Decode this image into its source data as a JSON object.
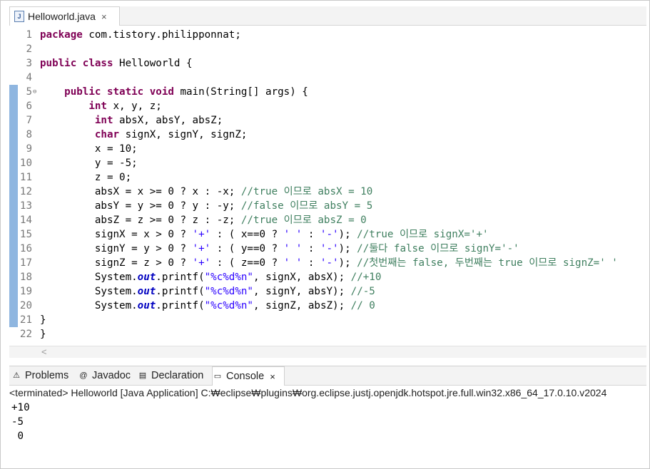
{
  "editor": {
    "tab": {
      "title": "Helloworld.java",
      "close": "×",
      "icon": "J"
    },
    "lines": [
      {
        "n": "1",
        "mark": false,
        "fold": "",
        "html": "<span class=\"kw\">package</span> com.tistory.philipponnat;"
      },
      {
        "n": "2",
        "mark": false,
        "fold": "",
        "html": ""
      },
      {
        "n": "3",
        "mark": false,
        "fold": "",
        "html": "<span class=\"kw\">public</span> <span class=\"kw\">class</span> Helloworld {"
      },
      {
        "n": "4",
        "mark": false,
        "fold": "",
        "html": ""
      },
      {
        "n": "5",
        "mark": true,
        "fold": "⊖",
        "html": "    <span class=\"kw\">public</span> <span class=\"kw\">static</span> <span class=\"kw\">void</span> main(String[] args) {"
      },
      {
        "n": "6",
        "mark": true,
        "fold": "",
        "html": "        <span class=\"kw\">int</span> x, y, z;"
      },
      {
        "n": "7",
        "mark": true,
        "fold": "",
        "html": "         <span class=\"kw\">int</span> absX, absY, absZ;"
      },
      {
        "n": "8",
        "mark": true,
        "fold": "",
        "html": "         <span class=\"kw\">char</span> signX, signY, signZ;"
      },
      {
        "n": "9",
        "mark": true,
        "fold": "",
        "html": "         x = 10;"
      },
      {
        "n": "10",
        "mark": true,
        "fold": "",
        "html": "         y = -5;"
      },
      {
        "n": "11",
        "mark": true,
        "fold": "",
        "html": "         z = 0;"
      },
      {
        "n": "12",
        "mark": true,
        "fold": "",
        "html": "         absX = x >= 0 ? x : -x; <span class=\"cm\">//true 이므로 absX = 10</span>"
      },
      {
        "n": "13",
        "mark": true,
        "fold": "",
        "html": "         absY = y >= 0 ? y : -y; <span class=\"cm\">//false 이므로 absY = 5</span>"
      },
      {
        "n": "14",
        "mark": true,
        "fold": "",
        "html": "         absZ = z >= 0 ? z : -z; <span class=\"cm\">//true 이므로 absZ = 0</span>"
      },
      {
        "n": "15",
        "mark": true,
        "fold": "",
        "html": "         signX = x > 0 ? <span class=\"str\">'+'</span> : ( x==0 ? <span class=\"str\">' '</span> : <span class=\"str\">'-'</span>); <span class=\"cm\">//true 이므로 signX='+'</span>"
      },
      {
        "n": "16",
        "mark": true,
        "fold": "",
        "html": "         signY = y > 0 ? <span class=\"str\">'+'</span> : ( y==0 ? <span class=\"str\">' '</span> : <span class=\"str\">'-'</span>); <span class=\"cm\">//둘다 false 이므로 signY='-'</span>"
      },
      {
        "n": "17",
        "mark": true,
        "fold": "",
        "html": "         signZ = z > 0 ? <span class=\"str\">'+'</span> : ( z==0 ? <span class=\"str\">' '</span> : <span class=\"str\">'-'</span>); <span class=\"cm\">//첫번째는 false, 두번째는 true 이므로 signZ=' '</span>"
      },
      {
        "n": "18",
        "mark": true,
        "fold": "",
        "html": "         System.<span class=\"fld\">out</span>.printf(<span class=\"str\">\"%c%d%n\"</span>, signX, absX); <span class=\"cm\">//+10</span>"
      },
      {
        "n": "19",
        "mark": true,
        "fold": "",
        "html": "         System.<span class=\"fld\">out</span>.printf(<span class=\"str\">\"%c%d%n\"</span>, signY, absY); <span class=\"cm\">//-5</span>"
      },
      {
        "n": "20",
        "mark": true,
        "fold": "",
        "html": "         System.<span class=\"fld\">out</span>.printf(<span class=\"str\">\"%c%d%n\"</span>, signZ, absZ); <span class=\"cm\">// 0</span>"
      },
      {
        "n": "21",
        "mark": true,
        "fold": "",
        "html": "}"
      },
      {
        "n": "22",
        "mark": false,
        "fold": "",
        "html": "}"
      }
    ],
    "scroll_arrow": "<"
  },
  "views": {
    "tabs": [
      {
        "label": "Problems",
        "icon": "⚠",
        "icon_name": "problems-icon",
        "active": false
      },
      {
        "label": "Javadoc",
        "icon": "@",
        "icon_name": "javadoc-icon",
        "active": false
      },
      {
        "label": "Declaration",
        "icon": "▤",
        "icon_name": "declaration-icon",
        "active": false
      },
      {
        "label": "Console",
        "icon": "▭",
        "icon_name": "console-icon",
        "active": true
      }
    ],
    "console_close": "×"
  },
  "console": {
    "header": "<terminated> Helloworld [Java Application] C:₩eclipse₩plugins₩org.eclipse.justj.openjdk.hotspot.jre.full.win32.x86_64_17.0.10.v2024",
    "output": [
      "+10",
      "-5",
      " 0"
    ]
  }
}
